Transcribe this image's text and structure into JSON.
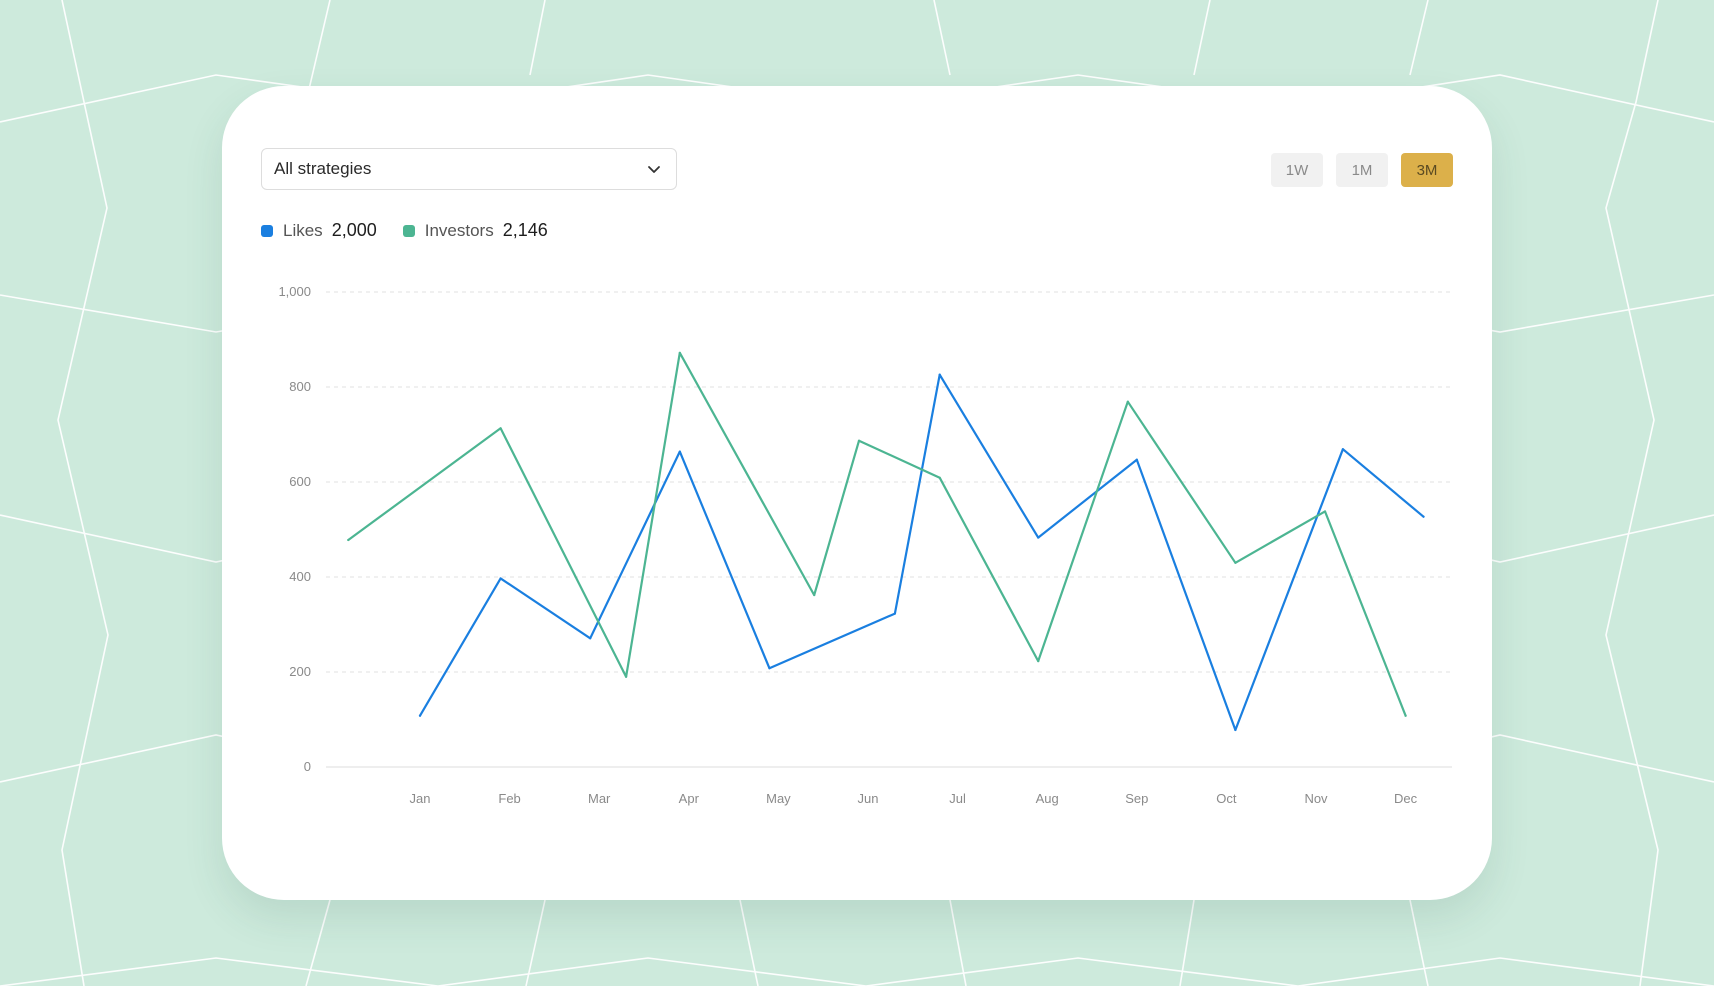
{
  "filter": {
    "selected": "All strategies",
    "icon": "chevron-down-icon"
  },
  "range_buttons": [
    "1W",
    "1M",
    "3M"
  ],
  "active_range": "3M",
  "legend": [
    {
      "name": "Likes",
      "total": "2,000",
      "color": "#1a7fe0"
    },
    {
      "name": "Investors",
      "total": "2,146",
      "color": "#4cb592"
    }
  ],
  "colors": {
    "background": "#cdeadc",
    "accent": "#dcb04a",
    "grid": "#e2e2e2"
  },
  "chart_data": {
    "type": "line",
    "categories": [
      "Jan",
      "Feb",
      "Mar",
      "Apr",
      "May",
      "Jun",
      "Jul",
      "Aug",
      "Sep",
      "Oct",
      "Nov",
      "Dec"
    ],
    "ylim": [
      0,
      1000
    ],
    "yticks": [
      0,
      200,
      400,
      600,
      800,
      1000
    ],
    "ytick_labels": [
      "0",
      "200",
      "400",
      "600",
      "800",
      "1,000"
    ],
    "grid": "horizontal dashed",
    "legend_position": "top-left",
    "series": [
      {
        "name": "Likes",
        "color": "#1a7fe0",
        "points": [
          {
            "x": 0.0,
            "y": 108
          },
          {
            "x": 0.9,
            "y": 397
          },
          {
            "x": 1.9,
            "y": 271
          },
          {
            "x": 2.9,
            "y": 664
          },
          {
            "x": 3.9,
            "y": 208
          },
          {
            "x": 5.3,
            "y": 323
          },
          {
            "x": 5.8,
            "y": 826
          },
          {
            "x": 6.9,
            "y": 483
          },
          {
            "x": 8.0,
            "y": 647
          },
          {
            "x": 9.1,
            "y": 78
          },
          {
            "x": 10.3,
            "y": 669
          },
          {
            "x": 11.2,
            "y": 527
          }
        ]
      },
      {
        "name": "Investors",
        "color": "#4cb592",
        "points": [
          {
            "x": -0.8,
            "y": 478
          },
          {
            "x": 0.9,
            "y": 713
          },
          {
            "x": 2.3,
            "y": 190
          },
          {
            "x": 2.9,
            "y": 872
          },
          {
            "x": 4.4,
            "y": 362
          },
          {
            "x": 4.9,
            "y": 687
          },
          {
            "x": 5.8,
            "y": 609
          },
          {
            "x": 6.9,
            "y": 223
          },
          {
            "x": 7.9,
            "y": 769
          },
          {
            "x": 9.1,
            "y": 430
          },
          {
            "x": 10.1,
            "y": 538
          },
          {
            "x": 11.0,
            "y": 108
          }
        ]
      }
    ]
  }
}
